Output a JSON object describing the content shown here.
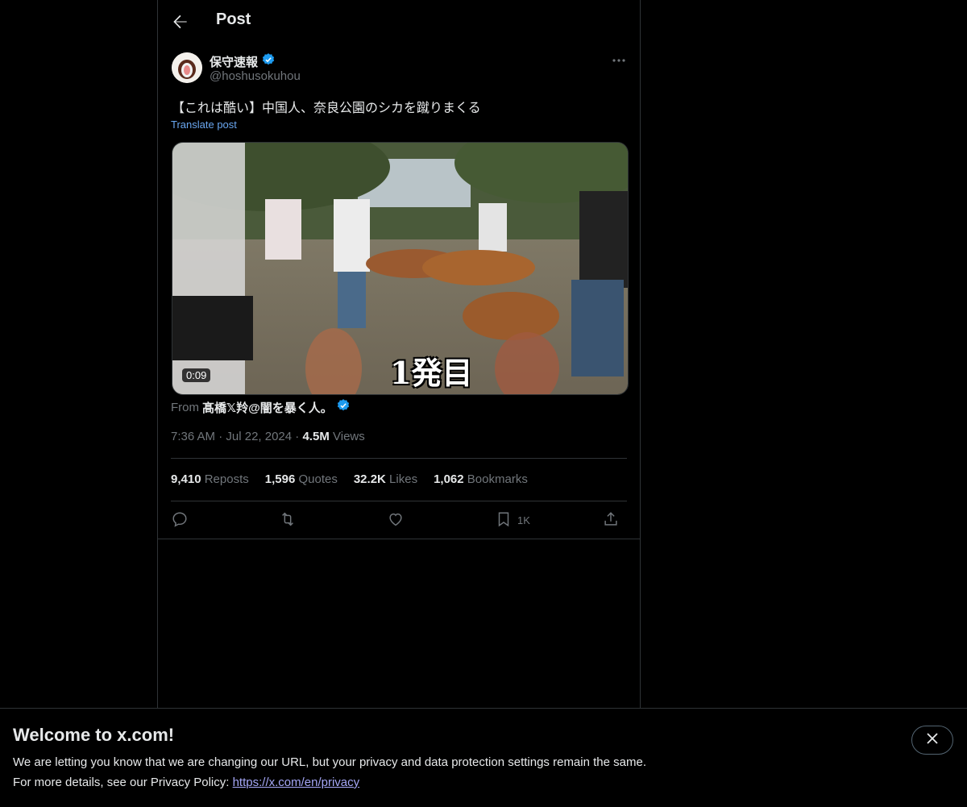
{
  "header": {
    "title": "Post"
  },
  "post": {
    "author_name": "保守速報",
    "author_handle": "@hoshusokuhou",
    "text": "【これは酷い】中国人、奈良公園のシカを蹴りまくる",
    "translate_label": "Translate post",
    "media": {
      "caption": "1発目",
      "duration": "0:09"
    },
    "from_label": "From",
    "from_name": "髙橋𝕏羚@闇を暴く人。",
    "time": "7:36 AM",
    "date": "Jul 22, 2024",
    "views_count": "4.5M",
    "views_label": "Views",
    "separator": "·"
  },
  "stats": {
    "reposts_count": "9,410",
    "reposts_label": "Reposts",
    "quotes_count": "1,596",
    "quotes_label": "Quotes",
    "likes_count": "32.2K",
    "likes_label": "Likes",
    "bookmarks_count": "1,062",
    "bookmarks_label": "Bookmarks"
  },
  "actions": {
    "bookmark_count": "1K"
  },
  "banner": {
    "title": "Welcome to x.com!",
    "line1": "We are letting you know that we are changing our URL, but your privacy and data protection settings remain the same.",
    "line2_prefix": "For more details, see our Privacy Policy: ",
    "link": "https://x.com/en/privacy"
  },
  "colors": {
    "accent": "#1d9bf0",
    "verified": "#1d9bf0",
    "muted": "#71767b",
    "border": "#2f3336"
  }
}
